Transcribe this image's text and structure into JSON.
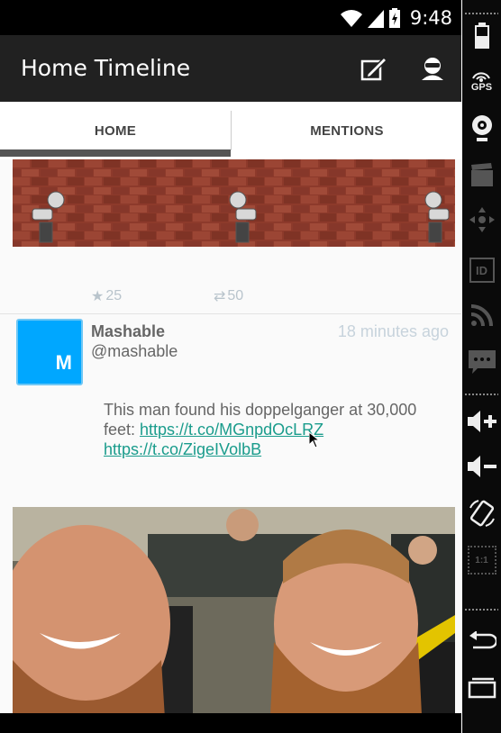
{
  "status_bar": {
    "time": "9:48"
  },
  "app_bar": {
    "title": "Home Timeline"
  },
  "tabs": [
    {
      "label": "HOME"
    },
    {
      "label": "MENTIONS"
    }
  ],
  "previous_tweet": {
    "favorites": "25",
    "retweets": "50"
  },
  "tweet": {
    "name": "Mashable",
    "handle": "@mashable",
    "time_ago": "18 minutes ago",
    "avatar_letter": "M",
    "text_prefix": "This man found his doppelganger at 30,000 feet: ",
    "link1": "https://t.co/MGnpdOcLRZ",
    "link2": "https://t.co/ZigeIVolbB"
  },
  "emulator_bar": {
    "gps_label": "GPS",
    "id_label": "ID",
    "scale_label": "1:1"
  },
  "colors": {
    "app_bar": "#212121",
    "link": "#1a9c8c",
    "avatar": "#00a7ff",
    "count": "#b9c4cc"
  }
}
